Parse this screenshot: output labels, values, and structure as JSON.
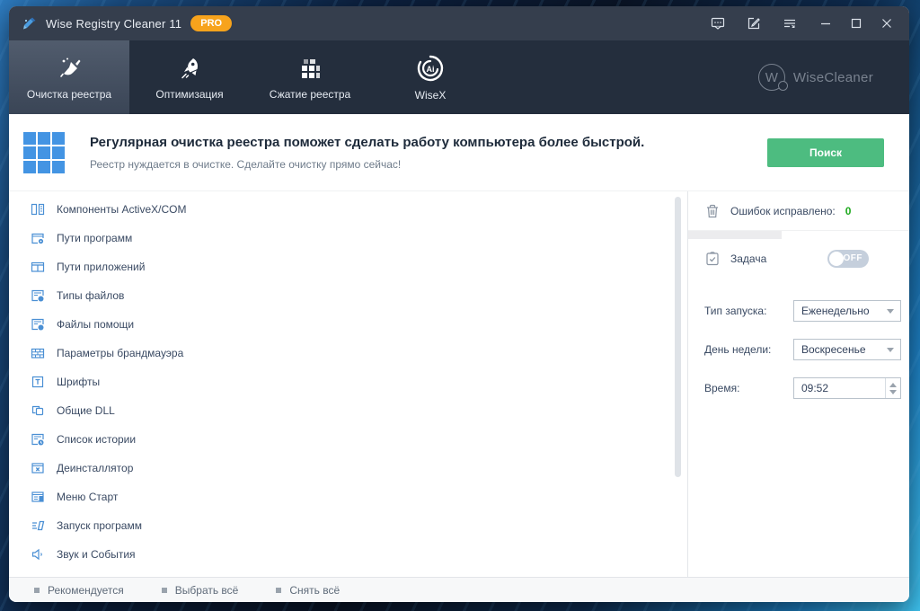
{
  "titlebar": {
    "title": "Wise Registry Cleaner 11",
    "badge": "PRO"
  },
  "nav": {
    "tabs": [
      {
        "label": "Очистка реестра",
        "icon": "broom-icon",
        "active": true
      },
      {
        "label": "Оптимизация",
        "icon": "rocket-icon",
        "active": false
      },
      {
        "label": "Сжатие реестра",
        "icon": "compress-grid-icon",
        "active": false
      },
      {
        "label": "WiseX",
        "icon": "wisex-ai-icon",
        "active": false
      }
    ],
    "brand": "WiseCleaner",
    "brand_letter": "W"
  },
  "banner": {
    "title": "Регулярная очистка реестра поможет сделать работу компьютера более быстрой.",
    "subtitle": "Реестр нуждается в очистке. Сделайте очистку прямо сейчас!",
    "search_button": "Поиск"
  },
  "categories": [
    "Компоненты ActiveX/COM",
    "Пути программ",
    "Пути приложений",
    "Типы файлов",
    "Файлы помощи",
    "Параметры брандмауэра",
    "Шрифты",
    "Общие DLL",
    "Список истории",
    "Деинсталлятор",
    "Меню Старт",
    "Запуск программ",
    "Звук и События"
  ],
  "panel": {
    "fixed_label": "Ошибок исправлено:",
    "fixed_count": "0",
    "task_label": "Задача",
    "toggle_state": "OFF",
    "run_type_label": "Тип запуска:",
    "run_type_value": "Еженедельно",
    "weekday_label": "День недели:",
    "weekday_value": "Воскресенье",
    "time_label": "Время:",
    "time_value": "09:52"
  },
  "footer": {
    "items": [
      "Рекомендуется",
      "Выбрать всё",
      "Снять всё"
    ]
  },
  "colors": {
    "accent_green": "#4dbc80",
    "badge_orange": "#f7a31c",
    "icon_blue": "#4a8fd4",
    "count_green": "#1faa1f",
    "titlebar_bg": "#353e4d",
    "nav_bg": "#242e3d"
  }
}
